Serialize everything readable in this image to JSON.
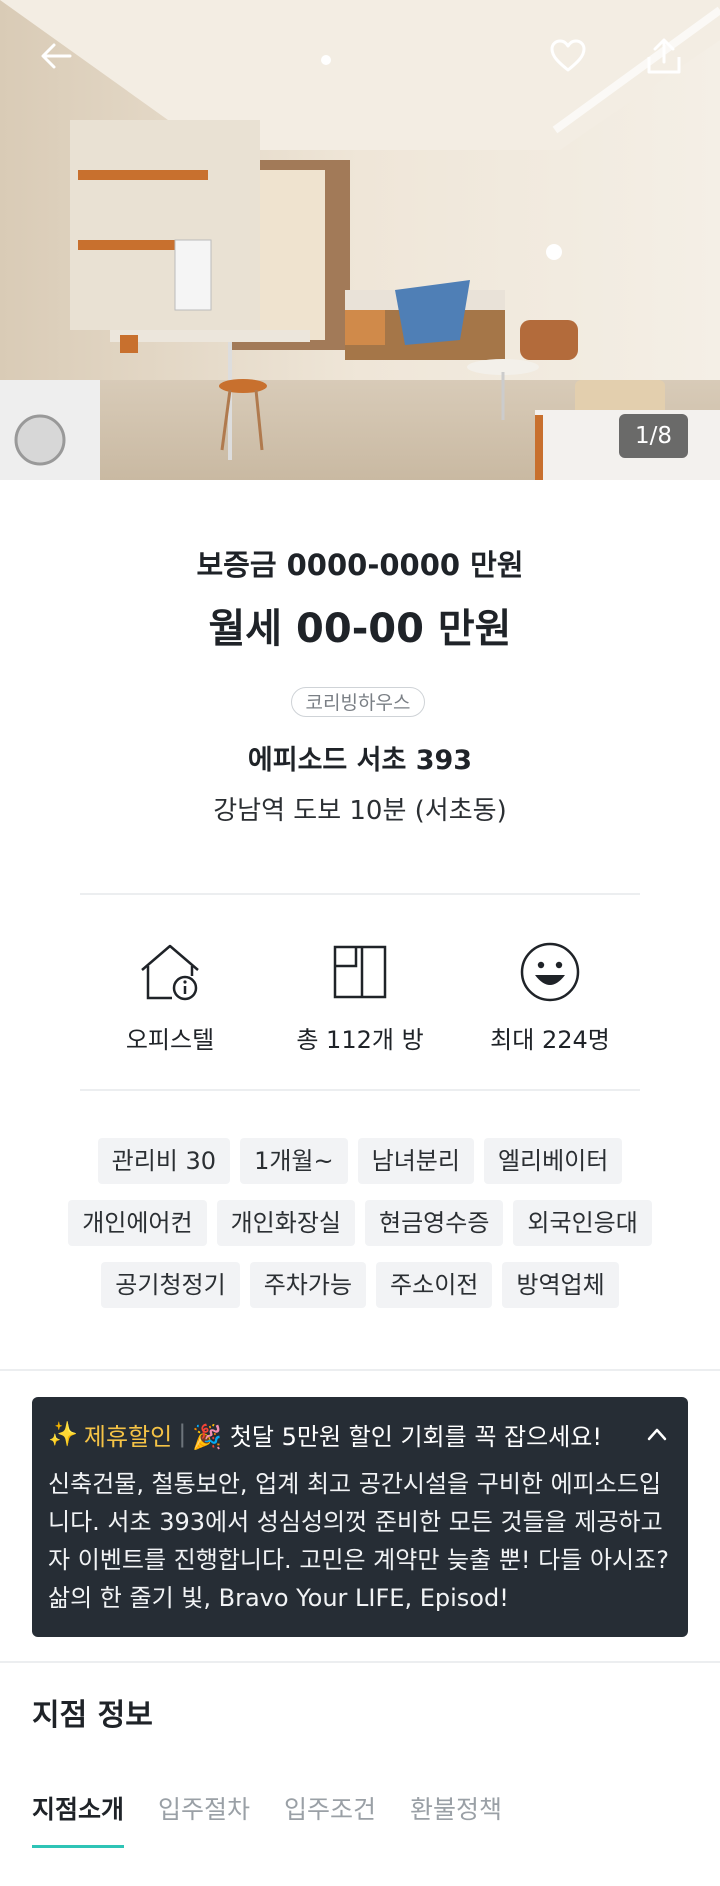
{
  "hero": {
    "counter": "1/8",
    "icons": {
      "back": "back-arrow-icon",
      "favorite": "heart-icon",
      "share": "share-icon"
    }
  },
  "summary": {
    "deposit": "보증금 0000-0000 만원",
    "rent": "월세 00-00 만원",
    "brand": "코리빙하우스",
    "name": "에피소드 서초 393",
    "location": "강남역 도보 10분 (서초동)"
  },
  "specs": [
    {
      "icon": "house-info-icon",
      "label": "오피스텔"
    },
    {
      "icon": "room-layout-icon",
      "label": "총 112개 방"
    },
    {
      "icon": "smiley-icon",
      "label": "최대 224명"
    }
  ],
  "tags": {
    "row1": [
      "관리비 30",
      "1개월~",
      "남녀분리",
      "엘리베이터"
    ],
    "row2": [
      "개인에어컨",
      "개인화장실",
      "현금영수증",
      "외국인응대"
    ],
    "row3": [
      "공기청정기",
      "주차가능",
      "주소이전",
      "방역업체"
    ]
  },
  "promo": {
    "sparkle": "✨",
    "label": "제휴할인",
    "divider": "|",
    "headline": "🎉 첫달 5만원 할인 기회를 꼭 잡으세요!",
    "body": "신축건물, 철통보안, 업계 최고 공간시설을 구비한 에피소드입니다. 서초 393에서 성심성의껏 준비한 모든 것들을 제공하고자 이벤트를 진행합니다. 고민은 계약만 늦출 뿐! 다들 아시죠? 삶의 한 줄기 빛, Bravo Your LIFE, Episod!"
  },
  "branch": {
    "title": "지점 정보",
    "tabs": [
      "지점소개",
      "입주절차",
      "입주조건",
      "환불정책"
    ],
    "active_tab": "지점소개"
  },
  "colors": {
    "accent": "#2ec4b6",
    "promo_bg": "#262d35",
    "promo_label": "#f5c346"
  }
}
